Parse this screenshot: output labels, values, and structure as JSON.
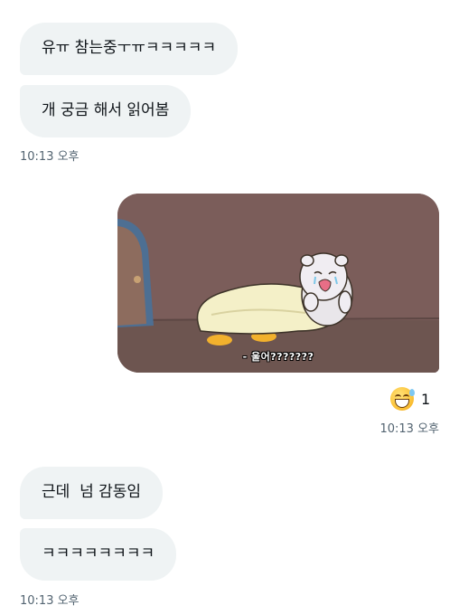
{
  "messages": {
    "m1": "유ㅠ 참는중ㅜㅠㅋㅋㅋㅋㅋ",
    "m2": "개 궁금 해서 읽어봄",
    "ts1": "10:13 오후",
    "media_caption": "- 울어???????",
    "reaction_count": "1",
    "ts2": "10:13 오후",
    "m3": "근데  넘 감동임",
    "m4": "ㅋㅋㅋㅋㅋㅋㅋㅋ",
    "ts3": "10:13 오후"
  },
  "icons": {
    "reaction": "grinning-sweat-emoji-icon"
  },
  "colors": {
    "bubble": "#eff3f4",
    "timestamp": "#536471",
    "text": "#0f1419"
  }
}
